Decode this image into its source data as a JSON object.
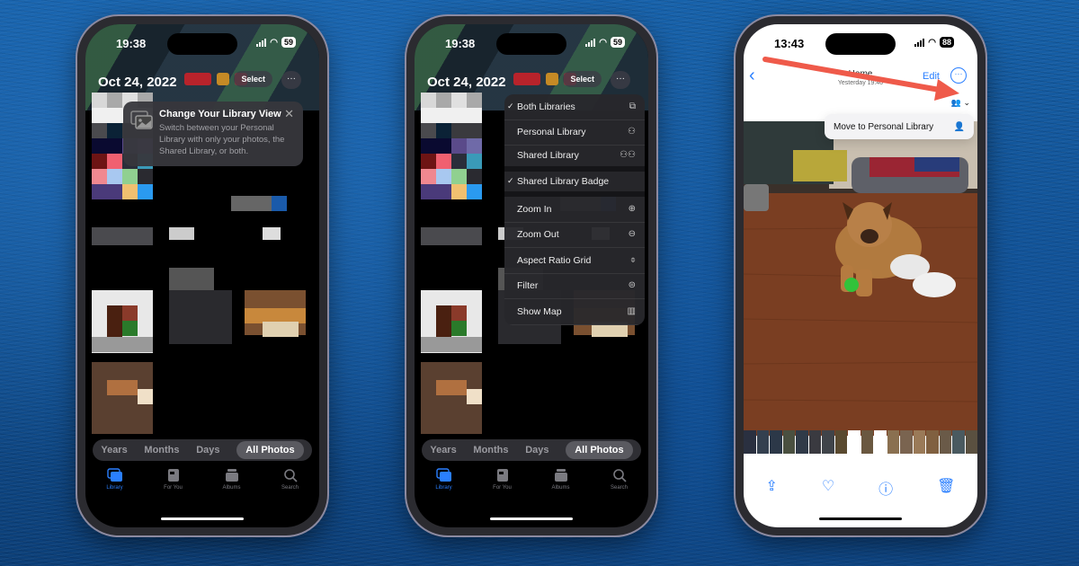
{
  "phone1": {
    "time": "19:38",
    "battery": "59",
    "date_title": "Oct 24, 2022",
    "select_label": "Select",
    "more_label": "···",
    "tip": {
      "title": "Change Your Library View",
      "body": "Switch between your Personal Library with only your photos, the Shared Library, or both.",
      "close": "✕"
    },
    "segments": [
      {
        "label": "Years",
        "active": false
      },
      {
        "label": "Months",
        "active": false
      },
      {
        "label": "Days",
        "active": false
      },
      {
        "label": "All Photos",
        "active": true
      }
    ],
    "tabs": [
      {
        "label": "Library",
        "icon": "photo-library-icon",
        "active": true
      },
      {
        "label": "For You",
        "icon": "for-you-icon",
        "active": false
      },
      {
        "label": "Albums",
        "icon": "albums-icon",
        "active": false
      },
      {
        "label": "Search",
        "icon": "search-icon",
        "active": false
      }
    ]
  },
  "phone2": {
    "time": "19:38",
    "battery": "59",
    "date_title": "Oct 24, 2022",
    "select_label": "Select",
    "more_label": "···",
    "menu": [
      {
        "label": "Both Libraries",
        "checked": true,
        "icon": "both-libraries-icon"
      },
      {
        "label": "Personal Library",
        "checked": false,
        "icon": "person-icon"
      },
      {
        "label": "Shared Library",
        "checked": false,
        "icon": "people-icon"
      },
      {
        "label": "Shared Library Badge",
        "checked": true,
        "icon": ""
      },
      {
        "label": "Zoom In",
        "checked": false,
        "icon": "zoom-in-icon"
      },
      {
        "label": "Zoom Out",
        "checked": false,
        "icon": "zoom-out-icon"
      },
      {
        "label": "Aspect Ratio Grid",
        "checked": false,
        "icon": "aspect-ratio-icon"
      },
      {
        "label": "Filter",
        "checked": false,
        "icon": "filter-icon"
      },
      {
        "label": "Show Map",
        "checked": false,
        "icon": "map-icon"
      }
    ],
    "check_glyph": "✓",
    "segments": [
      {
        "label": "Years",
        "active": false
      },
      {
        "label": "Months",
        "active": false
      },
      {
        "label": "Days",
        "active": false
      },
      {
        "label": "All Photos",
        "active": true
      }
    ],
    "tabs": [
      {
        "label": "Library",
        "icon": "photo-library-icon",
        "active": true
      },
      {
        "label": "For You",
        "icon": "for-you-icon",
        "active": false
      },
      {
        "label": "Albums",
        "icon": "albums-icon",
        "active": false
      },
      {
        "label": "Search",
        "icon": "search-icon",
        "active": false
      }
    ]
  },
  "phone3": {
    "time": "13:43",
    "battery": "88",
    "nav_title": "Home",
    "nav_subtitle": "Yesterday 19:40",
    "back_glyph": "‹",
    "edit_label": "Edit",
    "more_label": "···",
    "library_button": "👥 ⌄",
    "move_menu_label": "Move to Personal Library",
    "actions": [
      {
        "name": "share",
        "glyph": "⇪"
      },
      {
        "name": "favorite",
        "glyph": "♡"
      },
      {
        "name": "info",
        "glyph": "ⓘ"
      },
      {
        "name": "delete",
        "glyph": "🗑"
      }
    ]
  },
  "colors": {
    "accent": "#2a7fff",
    "arrow": "#ef5a4a",
    "background": "#0f4a86"
  }
}
